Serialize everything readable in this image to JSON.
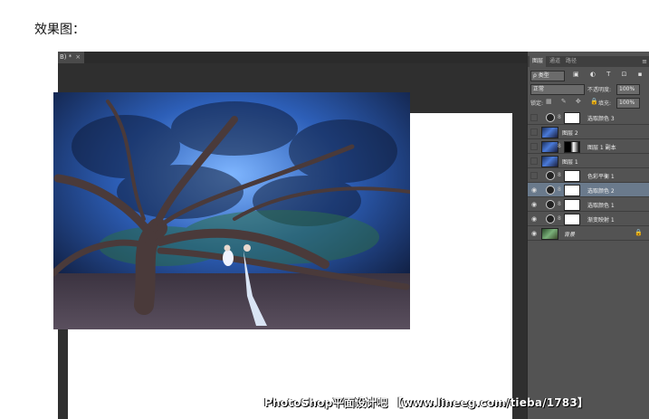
{
  "page": {
    "title": "效果图："
  },
  "document": {
    "tab_label": "B) *",
    "close": "×"
  },
  "watermark": "PhotoShop平面设计吧 【www.lineeg.com/tieba/1783】",
  "panel": {
    "tabs": [
      "图层",
      "通道",
      "路径"
    ],
    "menu": "≡",
    "kind_filter": "ρ 类型",
    "filter_icons": "▣ ◐ T ⊡ ▪",
    "blend_mode": "正常",
    "opacity_label": "不透明度:",
    "opacity_value": "100%",
    "lock_label": "锁定:",
    "lock_icons": "▦ ✎ ✥ 🔒",
    "fill_label": "填充:",
    "fill_value": "100%"
  },
  "layers": [
    {
      "name": "选取颜色 3",
      "visible": false,
      "type": "adjust",
      "selected": false
    },
    {
      "name": "图层 2",
      "visible": false,
      "type": "image",
      "selected": false
    },
    {
      "name": "图层 1 副本",
      "visible": false,
      "type": "image-mask",
      "selected": false
    },
    {
      "name": "图层 1",
      "visible": false,
      "type": "image",
      "selected": false
    },
    {
      "name": "色彩平衡 1",
      "visible": false,
      "type": "adjust",
      "selected": false
    },
    {
      "name": "选取颜色 2",
      "visible": true,
      "type": "adjust",
      "selected": true
    },
    {
      "name": "选取颜色 1",
      "visible": true,
      "type": "adjust",
      "selected": false
    },
    {
      "name": "渐变映射 1",
      "visible": true,
      "type": "adjust",
      "selected": false
    },
    {
      "name": "背景",
      "visible": true,
      "type": "background",
      "selected": false
    }
  ],
  "colors": {
    "accent_selected": "#6a7a8c",
    "panel_bg": "#535353",
    "canvas_bg": "#2f2f2f"
  }
}
